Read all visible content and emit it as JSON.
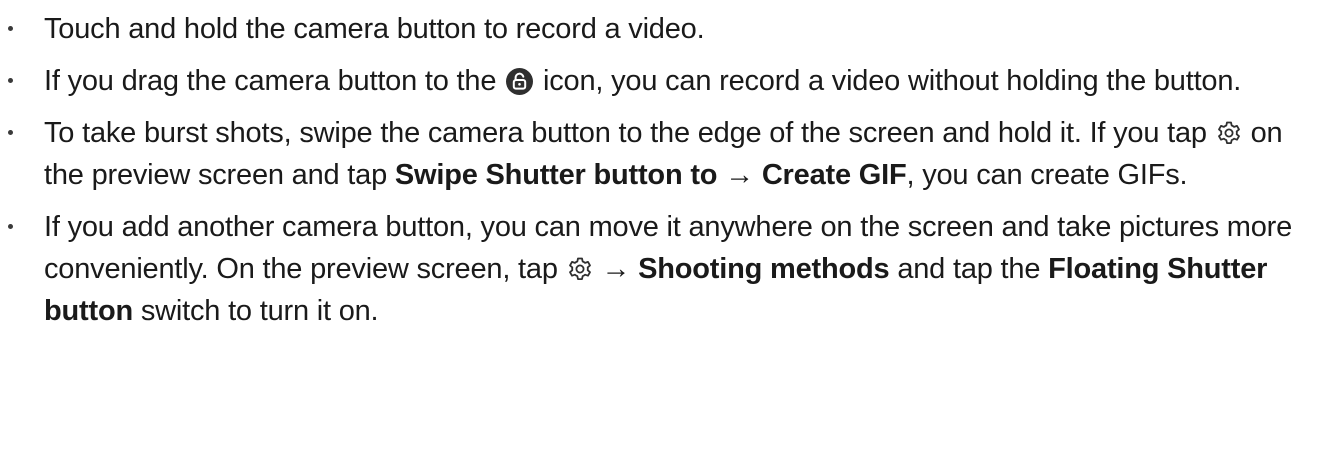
{
  "bullets": [
    {
      "text": "Touch and hold the camera button to record a video."
    },
    {
      "before_icon": "If you drag the camera button to the ",
      "icon": "unlock-icon",
      "after_icon": " icon, you can record a video without holding the button."
    },
    {
      "part1": "To take burst shots, swipe the camera button to the edge of the screen and hold it. If you tap ",
      "icon": "gear-icon",
      "part2": " on the preview screen and tap ",
      "bold1": "Swipe Shutter button to",
      "arrow": " → ",
      "bold2": "Create GIF",
      "part3": ", you can create GIFs."
    },
    {
      "part1": "If you add another camera button, you can move it anywhere on the screen and take pictures more conveniently. On the preview screen, tap ",
      "icon": "gear-icon",
      "arrow": " → ",
      "bold1": "Shooting methods",
      "part2": " and tap the ",
      "bold2": "Floating Shutter button",
      "part3": " switch to turn it on."
    }
  ],
  "colors": {
    "text": "#1a1a1a",
    "icon_fill": "#2f2f2f"
  }
}
